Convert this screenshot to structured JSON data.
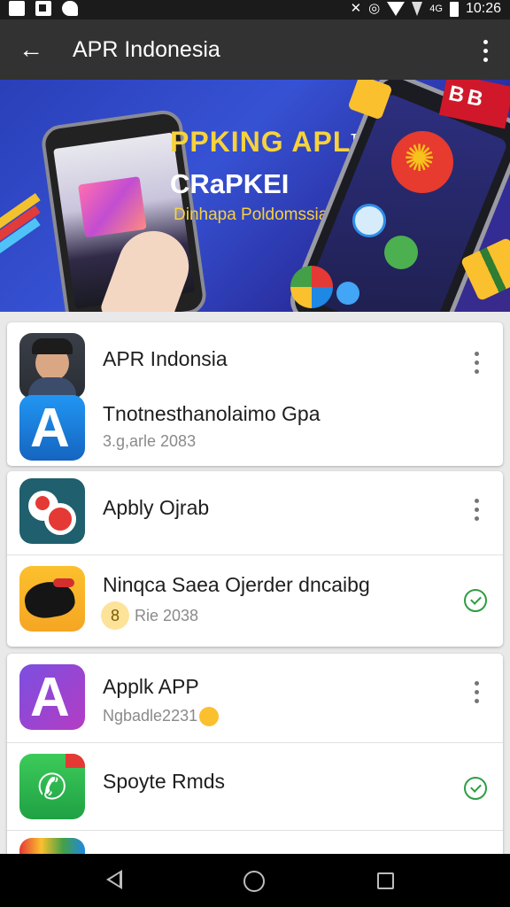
{
  "status_bar": {
    "time": "10:26",
    "icons": [
      "notification-icon",
      "image-icon",
      "messenger-icon",
      "mute-icon",
      "sync-icon",
      "wifi-icon",
      "signal-icon",
      "battery-icon"
    ],
    "signal_label": "4G"
  },
  "app_bar": {
    "title": "APR Indonesia",
    "back_icon": "arrow-left-icon",
    "menu_icon": "more-vert-icon"
  },
  "banner": {
    "headline_1": "PPKING APL",
    "headline_tm": "TM",
    "headline_2": "CRaPKEI",
    "subtitle": "Dinhapa Poldomssial"
  },
  "list": [
    {
      "card": 1,
      "rows": [
        {
          "title": "APR Indonsia",
          "subtitle": "",
          "icon": "profile-avatar-icon",
          "action": "more-vert-icon"
        },
        {
          "title": "Tnotnesthanolaimo Gpa",
          "subtitle": "3.g,arle 2083",
          "icon": "app-store-icon",
          "action": ""
        }
      ]
    },
    {
      "card": 2,
      "rows": [
        {
          "title": "Apbly Ojrab",
          "subtitle": "",
          "icon": "dice-app-icon",
          "action": "more-vert-icon"
        },
        {
          "title": "Ninqca Saea Ojerder dncaibg",
          "subtitle": "Rie 2038",
          "subtitle_badge": "8",
          "icon": "bird-app-icon",
          "action": "check-circle-icon"
        }
      ]
    },
    {
      "card": 3,
      "rows": [
        {
          "title": "Applk APP",
          "subtitle": "Ngbadle2231",
          "icon": "app-store-purple-icon",
          "action": "more-vert-icon"
        },
        {
          "title": "Spoyte Rmds",
          "subtitle": "",
          "icon": "phone-app-icon",
          "action": "check-circle-icon"
        }
      ]
    }
  ],
  "colors": {
    "app_bar": "#323232",
    "status_bar": "#1b1b1b",
    "banner_blue": "#2a3fb8",
    "banner_yellow": "#f7d23b",
    "check_green": "#2e9e43"
  }
}
